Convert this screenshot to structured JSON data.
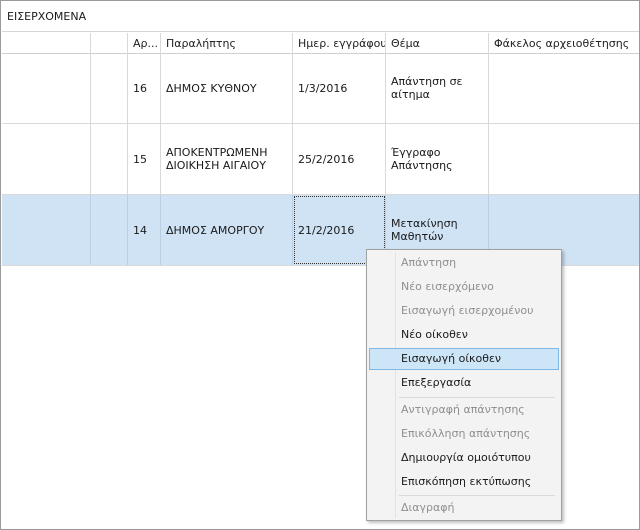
{
  "group": {
    "title": "ΕΙΣΕΡΧΟΜΕΝΑ"
  },
  "table": {
    "columns": [
      "",
      "",
      "Αρ...",
      "Παραλήπτης",
      "Ημερ. εγγράφου",
      "Θέμα",
      "Φάκελος αρχειοθέτησης"
    ],
    "rows": [
      {
        "num": "16",
        "recipient": "ΔΗΜΟΣ ΚΥΘΝΟΥ",
        "date": "1/3/2016",
        "subject": "Απάντηση σε αίτημα",
        "folder": "",
        "selected": false
      },
      {
        "num": "15",
        "recipient": "ΑΠΟΚΕΝΤΡΩΜΕΝΗ ΔΙΟΙΚΗΣΗ ΑΙΓΑΙΟΥ",
        "date": "25/2/2016",
        "subject": "Έγγραφο Απάντησης",
        "folder": "",
        "selected": false
      },
      {
        "num": "14",
        "recipient": "ΔΗΜΟΣ ΑΜΟΡΓΟΥ",
        "date": "21/2/2016",
        "subject": "Μετακίνηση Μαθητών",
        "folder": "",
        "selected": true
      }
    ]
  },
  "context_menu": {
    "items": [
      {
        "label": "Απάντηση",
        "enabled": false
      },
      {
        "label": "Νέο εισερχόμενο",
        "enabled": false
      },
      {
        "label": "Εισαγωγή εισερχομένου",
        "enabled": false
      },
      {
        "label": "Νέο οίκοθεν",
        "enabled": true
      },
      {
        "label": "Εισαγωγή οίκοθεν",
        "enabled": true,
        "highlighted": true
      },
      {
        "label": "Επεξεργασία",
        "enabled": true
      },
      {
        "label": "Αντιγραφή απάντησης",
        "enabled": false
      },
      {
        "label": "Επικόλληση απάντησης",
        "enabled": false
      },
      {
        "label": "Δημιουργία ομοιότυπου",
        "enabled": true
      },
      {
        "label": "Επισκόπηση εκτύπωσης",
        "enabled": true
      },
      {
        "label": "Διαγραφή",
        "enabled": false
      }
    ]
  },
  "colors": {
    "selection": "#cfe3f5",
    "menu_highlight": "#cde6f7",
    "disabled_text": "#8f8f8f"
  }
}
